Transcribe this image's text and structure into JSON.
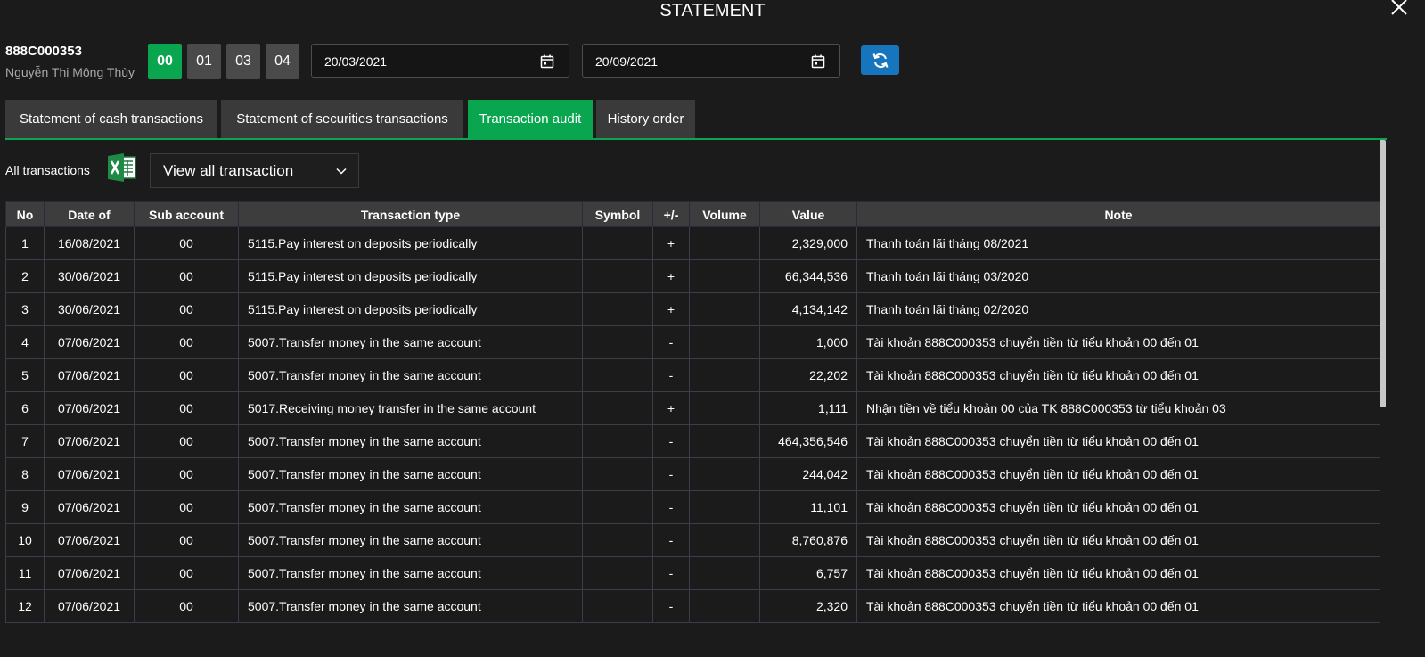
{
  "window": {
    "title": "STATEMENT"
  },
  "account": {
    "code": "888C000353",
    "name": "Nguyễn Thị Mộng Thùy"
  },
  "sub_accounts": [
    {
      "label": "00",
      "active": true
    },
    {
      "label": "01",
      "active": false
    },
    {
      "label": "03",
      "active": false
    },
    {
      "label": "04",
      "active": false
    }
  ],
  "date_range": {
    "from": "20/03/2021",
    "to": "20/09/2021"
  },
  "tabs": [
    {
      "label": "Statement of cash transactions",
      "active": false
    },
    {
      "label": "Statement of securities transactions",
      "active": false
    },
    {
      "label": "Transaction audit",
      "active": true
    },
    {
      "label": "History order",
      "active": false
    }
  ],
  "filter": {
    "label": "All transactions",
    "selected": "View all transaction"
  },
  "table": {
    "columns": [
      "No",
      "Date of",
      "Sub account",
      "Transaction type",
      "Symbol",
      "+/-",
      "Volume",
      "Value",
      "Note"
    ],
    "rows": [
      [
        "1",
        "16/08/2021",
        "00",
        "5115.Pay interest on deposits periodically",
        "",
        "+",
        "",
        "2,329,000",
        "Thanh toán lãi tháng 08/2021"
      ],
      [
        "2",
        "30/06/2021",
        "00",
        "5115.Pay interest on deposits periodically",
        "",
        "+",
        "",
        "66,344,536",
        "Thanh toán lãi tháng 03/2020"
      ],
      [
        "3",
        "30/06/2021",
        "00",
        "5115.Pay interest on deposits periodically",
        "",
        "+",
        "",
        "4,134,142",
        "Thanh toán lãi tháng 02/2020"
      ],
      [
        "4",
        "07/06/2021",
        "00",
        "5007.Transfer money in the same account",
        "",
        "-",
        "",
        "1,000",
        "Tài khoản 888C000353 chuyển tiền từ tiểu khoản 00 đến 01"
      ],
      [
        "5",
        "07/06/2021",
        "00",
        "5007.Transfer money in the same account",
        "",
        "-",
        "",
        "22,202",
        "Tài khoản 888C000353 chuyển tiền từ tiểu khoản 00 đến 01"
      ],
      [
        "6",
        "07/06/2021",
        "00",
        "5017.Receiving money transfer in the same account",
        "",
        "+",
        "",
        "1,111",
        "Nhận tiền về tiểu khoản 00 của TK 888C000353 từ tiểu khoản 03"
      ],
      [
        "7",
        "07/06/2021",
        "00",
        "5007.Transfer money in the same account",
        "",
        "-",
        "",
        "464,356,546",
        "Tài khoản 888C000353 chuyển tiền từ tiểu khoản 00 đến 01"
      ],
      [
        "8",
        "07/06/2021",
        "00",
        "5007.Transfer money in the same account",
        "",
        "-",
        "",
        "244,042",
        "Tài khoản 888C000353 chuyển tiền từ tiểu khoản 00 đến 01"
      ],
      [
        "9",
        "07/06/2021",
        "00",
        "5007.Transfer money in the same account",
        "",
        "-",
        "",
        "11,101",
        "Tài khoản 888C000353 chuyển tiền từ tiểu khoản 00 đến 01"
      ],
      [
        "10",
        "07/06/2021",
        "00",
        "5007.Transfer money in the same account",
        "",
        "-",
        "",
        "8,760,876",
        "Tài khoản 888C000353 chuyển tiền từ tiểu khoản 00 đến 01"
      ],
      [
        "11",
        "07/06/2021",
        "00",
        "5007.Transfer money in the same account",
        "",
        "-",
        "",
        "6,757",
        "Tài khoản 888C000353 chuyển tiền từ tiểu khoản 00 đến 01"
      ],
      [
        "12",
        "07/06/2021",
        "00",
        "5007.Transfer money in the same account",
        "",
        "-",
        "",
        "2,320",
        "Tài khoản 888C000353 chuyển tiền từ tiểu khoản 00 đến 01"
      ]
    ]
  },
  "icons": {
    "close": "close-icon",
    "calendar": "calendar-icon",
    "refresh": "refresh-icon",
    "excel": "excel-icon",
    "dropdown": "chevron-down-icon"
  },
  "colors": {
    "accent_green": "#0aa64f",
    "refresh_blue": "#1775bd",
    "background": "#1b1b1b",
    "tab_inactive": "#3a3a3a"
  }
}
